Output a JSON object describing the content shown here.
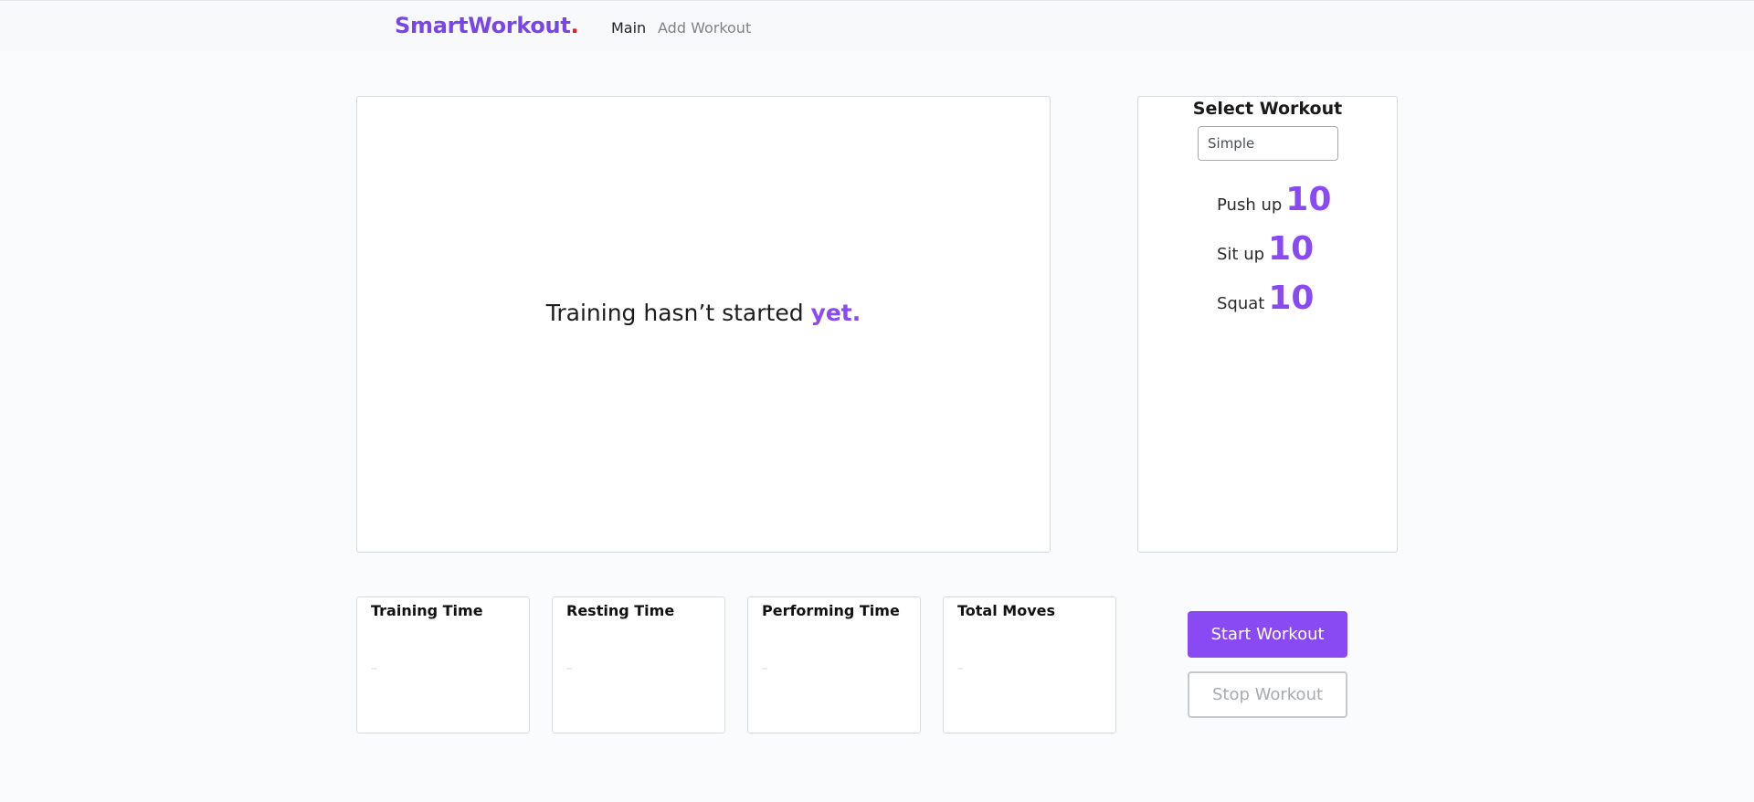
{
  "brand": {
    "name": "SmartWorkout",
    "dot": "."
  },
  "nav": {
    "main": "Main",
    "add_workout": "Add Workout"
  },
  "stage": {
    "message": "Training hasn’t started",
    "highlight": "yet",
    "dot": "."
  },
  "select_panel": {
    "title": "Select Workout",
    "selected": "Simple",
    "exercises": [
      {
        "name": "Push up",
        "count": "10"
      },
      {
        "name": "Sit up",
        "count": "10"
      },
      {
        "name": "Squat",
        "count": "10"
      }
    ]
  },
  "stats": [
    {
      "label": "Training Time",
      "value": "–"
    },
    {
      "label": "Resting Time",
      "value": "–"
    },
    {
      "label": "Performing Time",
      "value": "–"
    },
    {
      "label": "Total Moves",
      "value": "–"
    }
  ],
  "buttons": {
    "start": "Start Workout",
    "stop": "Stop Workout"
  },
  "colors": {
    "accent": "#8a4af3",
    "brand": "#7a45e8",
    "dot": "#ef1d2a"
  }
}
